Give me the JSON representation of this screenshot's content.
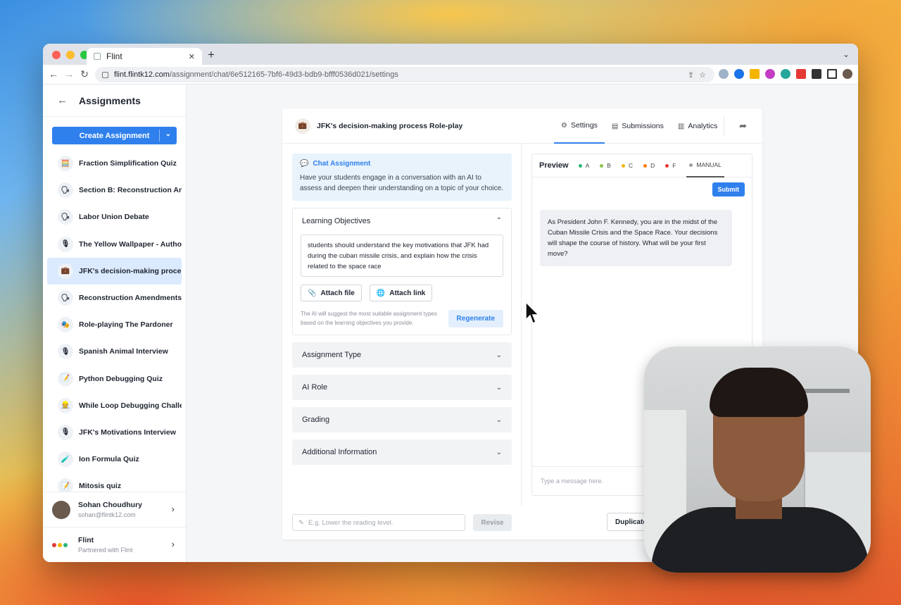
{
  "browser": {
    "tab_title": "Flint",
    "url_host": "flint.flintk12.com",
    "url_path": "/assignment/chat/6e512165-7bf6-49d3-bdb9-bfff0536d021/settings"
  },
  "sidebar": {
    "title": "Assignments",
    "create_label": "Create Assignment",
    "items": [
      {
        "label": "Fraction Simplification Quiz",
        "icon": "🧮"
      },
      {
        "label": "Section B: Reconstruction Amen…",
        "icon": "🗣"
      },
      {
        "label": "Labor Union Debate",
        "icon": "🗣"
      },
      {
        "label": "The Yellow Wallpaper - Author I…",
        "icon": "🎙"
      },
      {
        "label": "JFK's decision-making process …",
        "icon": "💼"
      },
      {
        "label": "Reconstruction Amendments De…",
        "icon": "🗣"
      },
      {
        "label": "Role-playing The Pardoner",
        "icon": "🎭"
      },
      {
        "label": "Spanish Animal Interview",
        "icon": "🎙"
      },
      {
        "label": "Python Debugging Quiz",
        "icon": "📝"
      },
      {
        "label": "While Loop Debugging Challenge",
        "icon": "👷"
      },
      {
        "label": "JFK's Motivations Interview",
        "icon": "🎙"
      },
      {
        "label": "Ion Formula Quiz",
        "icon": "🧪"
      },
      {
        "label": "Mitosis quiz",
        "icon": "📝"
      }
    ],
    "user": {
      "name": "Sohan Choudhury",
      "email": "sohan@flintk12.com"
    },
    "org": {
      "name": "Flint",
      "sub": "Partnered with Flint"
    }
  },
  "card": {
    "title": "JFK's decision-making process Role-play",
    "tabs": {
      "settings": "Settings",
      "submissions": "Submissions",
      "analytics": "Analytics"
    }
  },
  "chat_box": {
    "title": "Chat Assignment",
    "desc": "Have your students engage in a conversation with an AI to assess and deepen their understanding on a topic of your choice."
  },
  "learning_objectives": {
    "title": "Learning Objectives",
    "text": "students should understand the key motivations that JFK had during the cuban missile crisis, and explain how the crisis related to the space race",
    "attach_file": "Attach file",
    "attach_link": "Attach link",
    "note": "The AI will suggest the most suitable assignment types based on the learning objectives you provide.",
    "regenerate": "Regenerate"
  },
  "sections": {
    "assignment_type": "Assignment Type",
    "ai_role": "AI Role",
    "grading": "Grading",
    "additional": "Additional Information"
  },
  "revise": {
    "placeholder": "E.g. Lower the reading level.",
    "button": "Revise"
  },
  "preview": {
    "title": "Preview",
    "grades": {
      "a": "A",
      "b": "B",
      "c": "C",
      "d": "D",
      "f": "F",
      "manual": "MANUAL"
    },
    "grade_colors": {
      "a": "#2bb673",
      "b": "#8bc34a",
      "c": "#f4b400",
      "d": "#f57c00",
      "f": "#e53935",
      "manual": "#9e9e9e"
    },
    "submit": "Submit",
    "message": "As President John F. Kennedy, you are in the midst of the Cuban Missile Crisis and the Space Race. Your decisions will shape the course of history. What will be your first move?",
    "input_placeholder": "Type a message here."
  },
  "footer": {
    "duplicate": "Duplicate"
  },
  "colors": {
    "accent": "#2f80ed",
    "active_row": "#dbeafe"
  }
}
